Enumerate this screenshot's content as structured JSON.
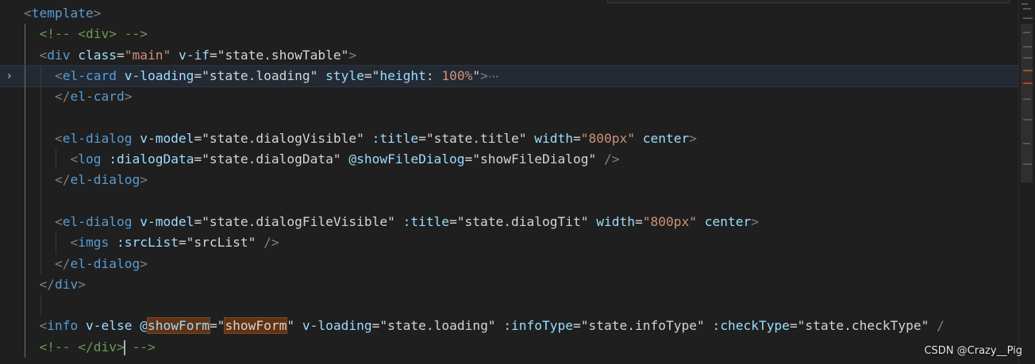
{
  "editor": {
    "lines": [
      {
        "id": "l1",
        "segments": [
          {
            "c": "t-br",
            "t": "<"
          },
          {
            "c": "t-tag",
            "t": "template"
          },
          {
            "c": "t-br",
            "t": ">"
          }
        ]
      },
      {
        "id": "l2",
        "segments": [
          {
            "c": "t-txt",
            "t": "  "
          },
          {
            "c": "t-com",
            "t": "<!-- <div> -->"
          }
        ]
      },
      {
        "id": "l3",
        "segments": [
          {
            "c": "t-txt",
            "t": "  "
          },
          {
            "c": "t-br",
            "t": "<"
          },
          {
            "c": "t-tag",
            "t": "div"
          },
          {
            "c": "t-txt",
            "t": " "
          },
          {
            "c": "t-attr",
            "t": "class"
          },
          {
            "c": "t-txt",
            "t": "="
          },
          {
            "c": "t-str",
            "t": "\"main\""
          },
          {
            "c": "t-txt",
            "t": " "
          },
          {
            "c": "t-attr",
            "t": "v-if"
          },
          {
            "c": "t-txt",
            "t": "=\"state.showTable\""
          },
          {
            "c": "t-br",
            "t": ">"
          }
        ]
      },
      {
        "id": "l4",
        "current": true,
        "segments": [
          {
            "c": "t-txt",
            "t": "    "
          },
          {
            "c": "t-br",
            "t": "<"
          },
          {
            "c": "t-tag",
            "t": "el-card"
          },
          {
            "c": "t-txt",
            "t": " "
          },
          {
            "c": "t-attr",
            "t": "v-loading"
          },
          {
            "c": "t-txt",
            "t": "=\"state.loading\""
          },
          {
            "c": "t-txt",
            "t": " "
          },
          {
            "c": "t-attr",
            "t": "style"
          },
          {
            "c": "t-txt",
            "t": "=\""
          },
          {
            "c": "t-attr",
            "t": "height"
          },
          {
            "c": "t-txt",
            "t": ": "
          },
          {
            "c": "t-str",
            "t": "100%"
          },
          {
            "c": "t-txt",
            "t": "\""
          },
          {
            "c": "t-br",
            "t": ">"
          },
          {
            "c": "t-fold",
            "t": "⋯"
          }
        ]
      },
      {
        "id": "l5",
        "segments": [
          {
            "c": "t-txt",
            "t": "    "
          },
          {
            "c": "t-br",
            "t": "</"
          },
          {
            "c": "t-tag",
            "t": "el-card"
          },
          {
            "c": "t-br",
            "t": ">"
          }
        ]
      },
      {
        "id": "l6",
        "segments": []
      },
      {
        "id": "l7",
        "segments": [
          {
            "c": "t-txt",
            "t": "    "
          },
          {
            "c": "t-br",
            "t": "<"
          },
          {
            "c": "t-tag",
            "t": "el-dialog"
          },
          {
            "c": "t-txt",
            "t": " "
          },
          {
            "c": "t-attr",
            "t": "v-model"
          },
          {
            "c": "t-txt",
            "t": "=\"state.dialogVisible\""
          },
          {
            "c": "t-txt",
            "t": " "
          },
          {
            "c": "t-attr",
            "t": ":title"
          },
          {
            "c": "t-txt",
            "t": "=\"state.title\""
          },
          {
            "c": "t-txt",
            "t": " "
          },
          {
            "c": "t-attr",
            "t": "width"
          },
          {
            "c": "t-txt",
            "t": "="
          },
          {
            "c": "t-str",
            "t": "\"800px\""
          },
          {
            "c": "t-txt",
            "t": " "
          },
          {
            "c": "t-attr",
            "t": "center"
          },
          {
            "c": "t-br",
            "t": ">"
          }
        ]
      },
      {
        "id": "l8",
        "segments": [
          {
            "c": "t-txt",
            "t": "      "
          },
          {
            "c": "t-br",
            "t": "<"
          },
          {
            "c": "t-tag",
            "t": "log"
          },
          {
            "c": "t-txt",
            "t": " "
          },
          {
            "c": "t-attr",
            "t": ":dialogData"
          },
          {
            "c": "t-txt",
            "t": "=\"state.dialogData\""
          },
          {
            "c": "t-txt",
            "t": " "
          },
          {
            "c": "t-attr",
            "t": "@showFileDialog"
          },
          {
            "c": "t-txt",
            "t": "=\"showFileDialog\""
          },
          {
            "c": "t-txt",
            "t": " "
          },
          {
            "c": "t-br",
            "t": "/>"
          }
        ]
      },
      {
        "id": "l9",
        "segments": [
          {
            "c": "t-txt",
            "t": "    "
          },
          {
            "c": "t-br",
            "t": "</"
          },
          {
            "c": "t-tag",
            "t": "el-dialog"
          },
          {
            "c": "t-br",
            "t": ">"
          }
        ]
      },
      {
        "id": "l10",
        "segments": []
      },
      {
        "id": "l11",
        "segments": [
          {
            "c": "t-txt",
            "t": "    "
          },
          {
            "c": "t-br",
            "t": "<"
          },
          {
            "c": "t-tag",
            "t": "el-dialog"
          },
          {
            "c": "t-txt",
            "t": " "
          },
          {
            "c": "t-attr",
            "t": "v-model"
          },
          {
            "c": "t-txt",
            "t": "=\"state.dialogFileVisible\""
          },
          {
            "c": "t-txt",
            "t": " "
          },
          {
            "c": "t-attr",
            "t": ":title"
          },
          {
            "c": "t-txt",
            "t": "=\"state.dialogTit\""
          },
          {
            "c": "t-txt",
            "t": " "
          },
          {
            "c": "t-attr",
            "t": "width"
          },
          {
            "c": "t-txt",
            "t": "="
          },
          {
            "c": "t-str",
            "t": "\"800px\""
          },
          {
            "c": "t-txt",
            "t": " "
          },
          {
            "c": "t-attr",
            "t": "center"
          },
          {
            "c": "t-br",
            "t": ">"
          }
        ]
      },
      {
        "id": "l12",
        "segments": [
          {
            "c": "t-txt",
            "t": "      "
          },
          {
            "c": "t-br",
            "t": "<"
          },
          {
            "c": "t-tag",
            "t": "imgs"
          },
          {
            "c": "t-txt",
            "t": " "
          },
          {
            "c": "t-attr",
            "t": ":srcList"
          },
          {
            "c": "t-txt",
            "t": "=\"srcList\""
          },
          {
            "c": "t-txt",
            "t": " "
          },
          {
            "c": "t-br",
            "t": "/>"
          }
        ]
      },
      {
        "id": "l13",
        "segments": [
          {
            "c": "t-txt",
            "t": "    "
          },
          {
            "c": "t-br",
            "t": "</"
          },
          {
            "c": "t-tag",
            "t": "el-dialog"
          },
          {
            "c": "t-br",
            "t": ">"
          }
        ]
      },
      {
        "id": "l14",
        "segments": [
          {
            "c": "t-txt",
            "t": "  "
          },
          {
            "c": "t-br",
            "t": "</"
          },
          {
            "c": "t-tag",
            "t": "div"
          },
          {
            "c": "t-br",
            "t": ">"
          }
        ]
      },
      {
        "id": "l15",
        "segments": []
      },
      {
        "id": "l16",
        "segments": [
          {
            "c": "t-txt",
            "t": "  "
          },
          {
            "c": "t-br",
            "t": "<"
          },
          {
            "c": "t-tag",
            "t": "info"
          },
          {
            "c": "t-txt",
            "t": " "
          },
          {
            "c": "t-attr",
            "t": "v-else"
          },
          {
            "c": "t-txt",
            "t": " "
          },
          {
            "c": "t-attr",
            "t": "@"
          },
          {
            "c": "t-attr hl",
            "t": "showForm"
          },
          {
            "c": "t-txt",
            "t": "=\""
          },
          {
            "c": "t-txt hl",
            "t": "showForm"
          },
          {
            "c": "t-txt",
            "t": "\""
          },
          {
            "c": "t-txt",
            "t": " "
          },
          {
            "c": "t-attr",
            "t": "v-loading"
          },
          {
            "c": "t-txt",
            "t": "=\"state.loading\""
          },
          {
            "c": "t-txt",
            "t": " "
          },
          {
            "c": "t-attr",
            "t": ":infoType"
          },
          {
            "c": "t-txt",
            "t": "=\"state.infoType\""
          },
          {
            "c": "t-txt",
            "t": " "
          },
          {
            "c": "t-attr",
            "t": ":checkType"
          },
          {
            "c": "t-txt",
            "t": "=\"state.checkType\""
          },
          {
            "c": "t-txt",
            "t": " "
          },
          {
            "c": "t-br",
            "t": "/"
          }
        ]
      },
      {
        "id": "l17",
        "segments": [
          {
            "c": "t-txt",
            "t": "  "
          },
          {
            "c": "t-com",
            "t": "<!-- </div>"
          },
          {
            "c": "cursor",
            "t": ""
          },
          {
            "c": "t-com",
            "t": " -->"
          }
        ]
      }
    ]
  },
  "watermark": {
    "text": "CSDN @Crazy__Pig"
  },
  "colors": {
    "background": "#1f1f1f",
    "tag": "#569cd6",
    "attribute": "#9cdcfe",
    "string": "#ce9178",
    "comment": "#6a9955",
    "match_highlight": "#613214"
  }
}
